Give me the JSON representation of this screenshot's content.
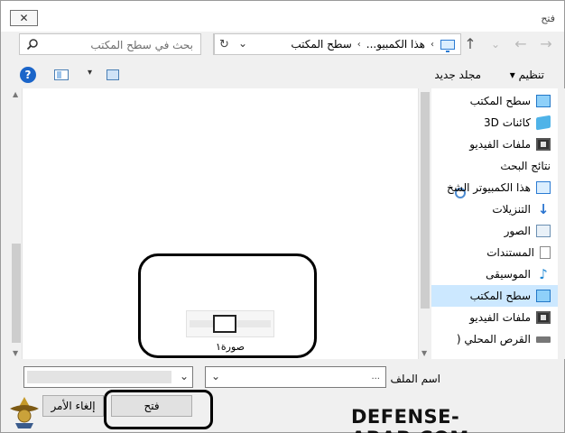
{
  "window": {
    "title": "فتح",
    "close_glyph": "✕"
  },
  "nav_buttons": {
    "back": "←",
    "forward": "→",
    "dropdown": "⌄",
    "up": "↑"
  },
  "address": {
    "crumbs": [
      "هذا الكمبيو...",
      "سطح المكتب"
    ],
    "separator": "›",
    "dropdown": "⌄",
    "refresh": "↻"
  },
  "search": {
    "placeholder": "بحث في سطح المكتب"
  },
  "toolbar": {
    "organize": "تنظيم ▾",
    "new_folder": "مجلد جديد",
    "help": "?",
    "view_dropdown": "▾"
  },
  "files": [
    {
      "name": "صورة١"
    }
  ],
  "nav_pane": {
    "items": [
      {
        "label": "سطح المكتب",
        "icon": "desktop-icon"
      },
      {
        "label": "كائنات 3D",
        "icon": "3d-objects-icon"
      },
      {
        "label": "ملفات الفيديو",
        "icon": "videos-icon"
      },
      {
        "label": "نتائج البحث",
        "icon": "search-results-icon"
      },
      {
        "label": "هذا الكمبيوتر الشخ",
        "icon": "this-pc-icon"
      },
      {
        "label": "التنزيلات",
        "icon": "downloads-icon"
      },
      {
        "label": "الصور",
        "icon": "pictures-icon"
      },
      {
        "label": "المستندات",
        "icon": "documents-icon"
      },
      {
        "label": "الموسيقى",
        "icon": "music-icon"
      },
      {
        "label": "سطح المكتب",
        "icon": "desktop-icon",
        "selected": true
      },
      {
        "label": "ملفات الفيديو",
        "icon": "videos-icon"
      },
      {
        "label": "القرص المحلي (",
        "icon": "local-disk-icon"
      }
    ],
    "selection_color": "#cce8ff"
  },
  "footer": {
    "filename_label": "اسم الملف",
    "filename_value": "...",
    "dropdown": "⌄",
    "open": "فتح",
    "cancel": "إلغاء الأمر"
  },
  "watermark": "DEFENSE-ARAB.COM",
  "colors": {
    "accent": "#1b65c9",
    "annotation": "#000000"
  }
}
